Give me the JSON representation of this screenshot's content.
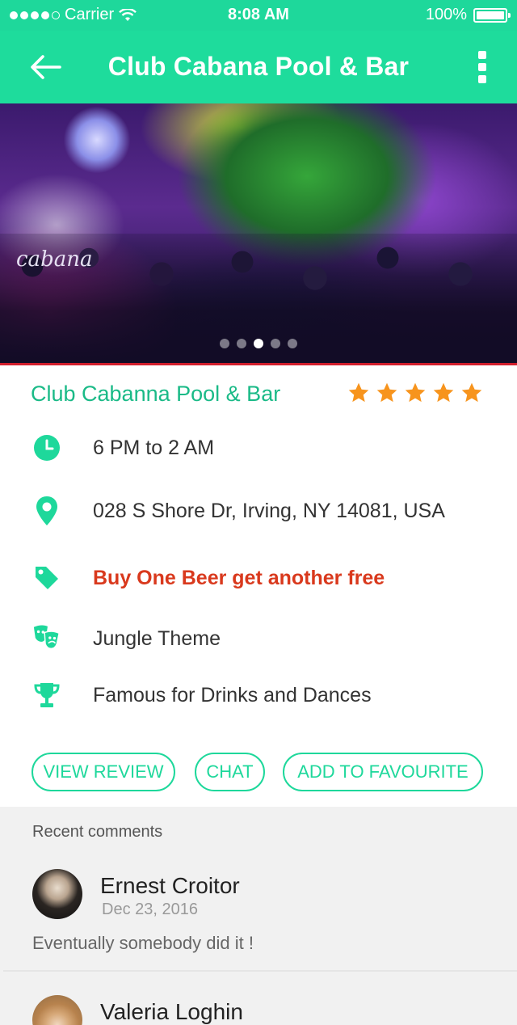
{
  "status_bar": {
    "carrier": "Carrier",
    "time": "8:08 AM",
    "battery": "100%"
  },
  "nav": {
    "title": "Club Cabana Pool & Bar",
    "back_icon": "arrow-left-icon",
    "more_icon": "more-vertical-icon"
  },
  "hero": {
    "logo_text": "cabana",
    "slides_total": 5,
    "active_slide": 3
  },
  "venue": {
    "name": "Club Cabanna Pool & Bar",
    "rating": 5,
    "rating_max": 5
  },
  "details": [
    {
      "icon": "clock-icon",
      "text": "6 PM to 2 AM"
    },
    {
      "icon": "location-pin-icon",
      "text": "028 S Shore Dr, Irving, NY 14081, USA"
    },
    {
      "icon": "tag-icon",
      "text": "Buy One Beer get another free"
    },
    {
      "icon": "theater-masks-icon",
      "text": "Jungle Theme"
    },
    {
      "icon": "trophy-icon",
      "text": "Famous for Drinks and Dances"
    }
  ],
  "actions": {
    "view_review": "VIEW REVIEW",
    "chat": "CHAT",
    "add_favourite": "ADD TO FAVOURITE"
  },
  "comments": {
    "heading": "Recent comments",
    "items": [
      {
        "name": "Ernest Croitor",
        "date": "Dec 23, 2016",
        "text": "Eventually somebody did it !"
      },
      {
        "name": "Valeria Loghin",
        "date": "",
        "text": ""
      }
    ]
  },
  "colors": {
    "primary": "#1ed89b",
    "title_green": "#1aba87",
    "promo_red": "#d9391d",
    "star_orange": "#f7941d"
  }
}
